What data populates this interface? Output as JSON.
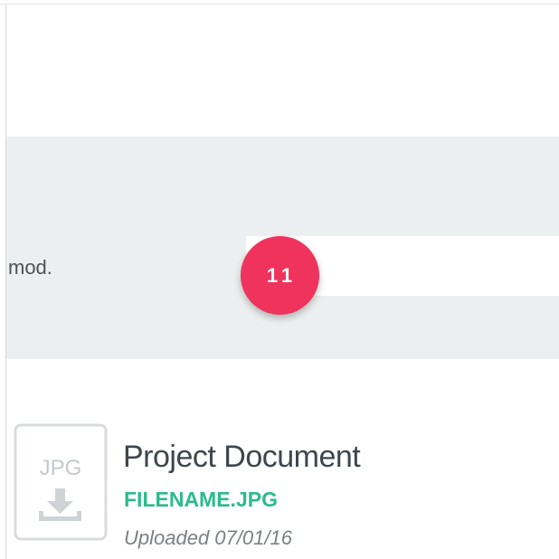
{
  "form_row": {
    "truncated_label": "mod.",
    "input_value": "",
    "step_badge": "11"
  },
  "file_item": {
    "type_label": "JPG",
    "icon": "download-tray-icon",
    "title": "Project Document",
    "filename": "FILENAME.JPG",
    "uploaded": "Uploaded 07/01/16"
  },
  "colors": {
    "badge": "#f0335c",
    "filename_accent": "#2dbb8b",
    "band_background": "#eceff0"
  }
}
